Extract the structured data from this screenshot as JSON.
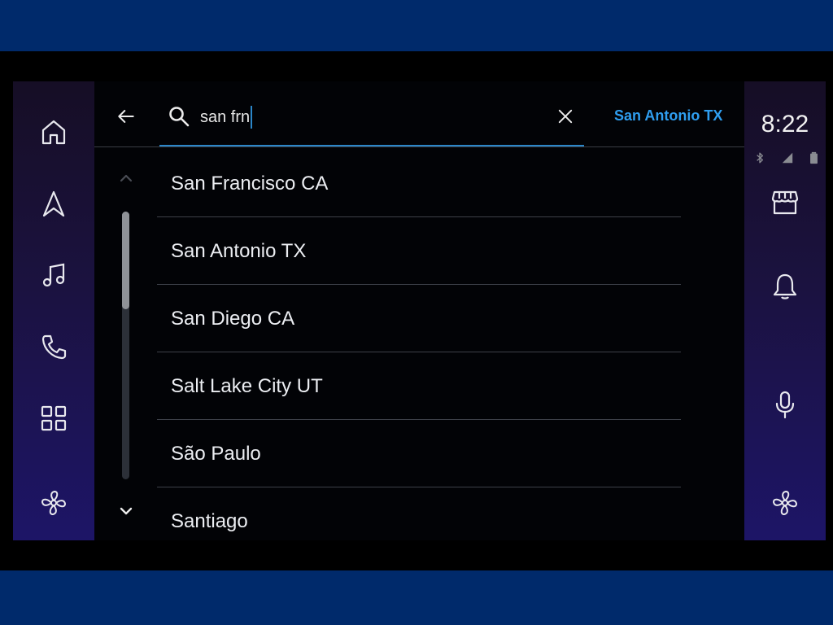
{
  "search": {
    "query": "san frn",
    "suggestion": "San Antonio TX"
  },
  "results": [
    "San Francisco CA",
    "San Antonio TX",
    "San Diego CA",
    "Salt Lake City UT",
    "São Paulo",
    "Santiago"
  ],
  "status": {
    "time": "8:22"
  },
  "colors": {
    "accent": "#2f9ef0",
    "band": "#002a6b",
    "rail_gradient_end": "#1d1567"
  },
  "nav": {
    "left_icons": [
      "home-icon",
      "navigation-icon",
      "music-icon",
      "phone-icon",
      "apps-grid-icon",
      "fan-icon"
    ],
    "right_icons": [
      "store-icon",
      "bell-icon",
      "microphone-icon",
      "fan-icon"
    ],
    "status_icons": [
      "bluetooth-icon",
      "signal-icon",
      "battery-icon"
    ]
  }
}
